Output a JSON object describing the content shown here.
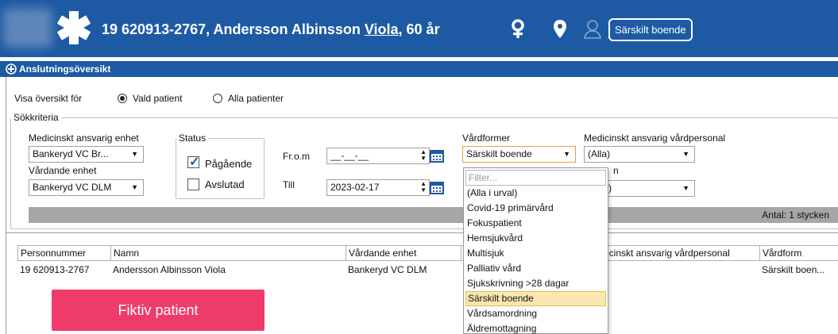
{
  "header": {
    "personnummer": "19 620913-2767,",
    "name": "Andersson Albinsson ",
    "firstname": "Viola",
    "age": ", 60 år",
    "boende_button": "Särskilt boende"
  },
  "section": {
    "title": "Anslutningsöversikt"
  },
  "visa": {
    "label": "Visa översikt för",
    "option_vald": "Vald patient",
    "option_alla": "Alla patienter",
    "selected": "Vald patient"
  },
  "sokkriterier": {
    "legend": "Sökkriteria",
    "med_enhet_label": "Medicinskt ansvarig enhet",
    "med_enhet_value": "Bankeryd VC Br...",
    "vardande_label": "Vårdande enhet",
    "vardande_value": "Bankeryd VC DLM",
    "status_legend": "Status",
    "status_pagaende": "Pågående",
    "status_avslutad": "Avslutad",
    "from_label": "Fr.o.m",
    "from_value": "__-__-__",
    "till_label": "Till",
    "till_value": "2023-02-17",
    "vardformer_label": "Vårdformer",
    "vardformer_value": "Särskilt boende",
    "med_personal_label": "Medicinskt ansvarig vårdpersonal",
    "med_personal_value": "(Alla)",
    "partial_label_fragment": "n",
    "partial_value_fragment": ")"
  },
  "antal": "Antal: 1 stycken",
  "table": {
    "headers": [
      "Personnummer",
      "Namn",
      "Vårdande enhet",
      "",
      "icinskt ansvarig vårdpersonal",
      "Vårdform"
    ],
    "rows": [
      [
        "19 620913-2767",
        "Andersson Albinsson Viola",
        "Bankeryd VC DLM",
        "",
        "",
        "Särskilt boen..."
      ]
    ]
  },
  "fiktiv_label": "Fiktiv patient",
  "dropdown": {
    "filter_placeholder": "Filter...",
    "options": [
      "(Alla i urval)",
      "Covid-19 primärvård",
      "Fokuspatient",
      "Hemsjukvård",
      "Multisjuk",
      "Palliativ vård",
      "Sjukskrivning >28 dagar",
      "Särskilt boende",
      "Vårdsamordning",
      "Äldremottagning"
    ],
    "highlighted": "Särskilt boende"
  },
  "colors": {
    "header_blue": "#1d5aa3",
    "fiktiv_pink": "#ef3b6a",
    "highlight": "#fbe7b0"
  }
}
